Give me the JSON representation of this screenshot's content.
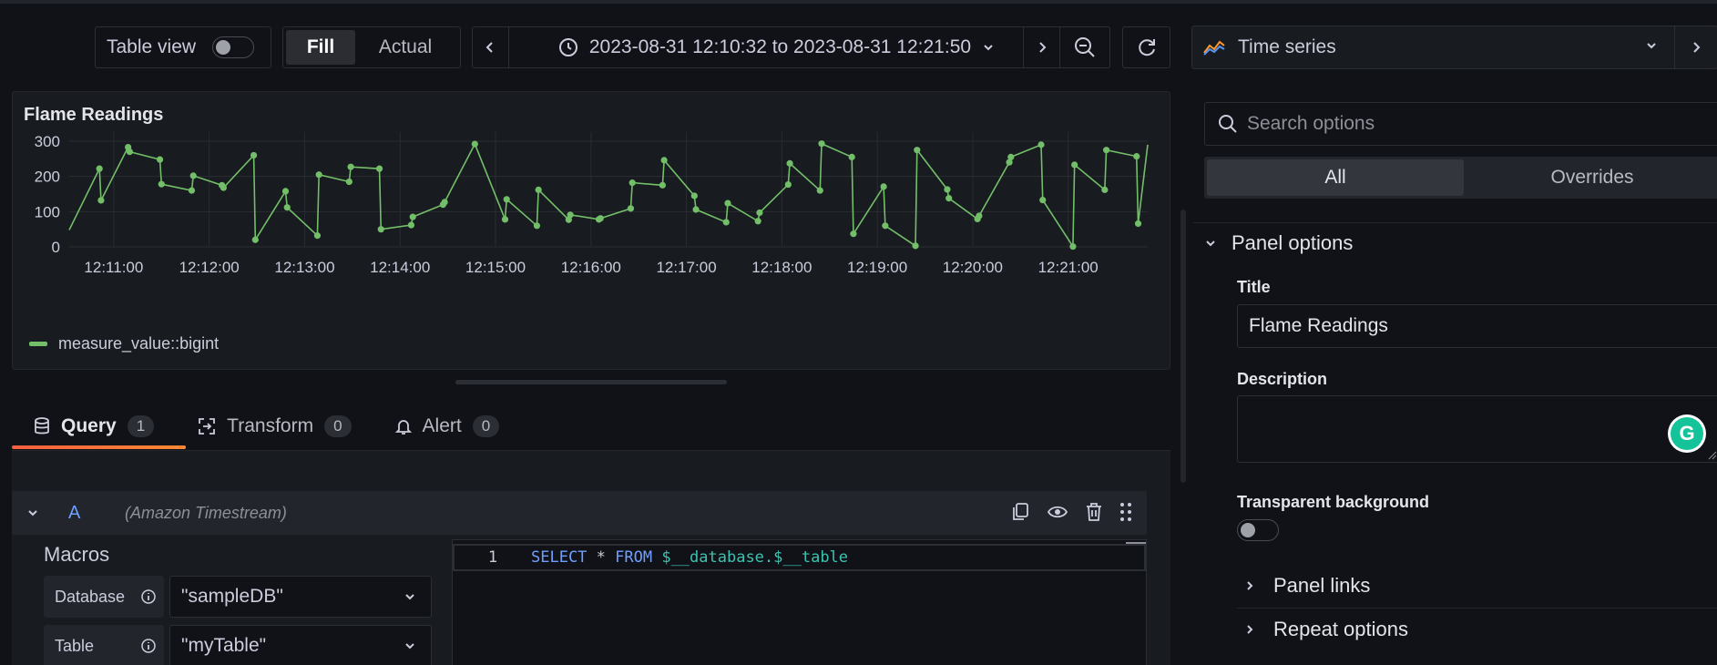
{
  "toolbar": {
    "table_view_label": "Table view",
    "fill_label": "Fill",
    "actual_label": "Actual",
    "time_range": "2023-08-31 12:10:32 to 2023-08-31 12:21:50"
  },
  "viz_picker": {
    "label": "Time series",
    "icon": "timeseries-icon"
  },
  "panel": {
    "title": "Flame Readings",
    "legend_label": "measure_value::bigint"
  },
  "chart_data": {
    "type": "line",
    "series": [
      {
        "name": "measure_value::bigint",
        "color": "#73bf69",
        "x": [
          "12:10:32",
          "12:10:51",
          "12:10:52",
          "12:11:09",
          "12:11:10",
          "12:11:29",
          "12:11:30",
          "12:11:49",
          "12:11:50",
          "12:12:08",
          "12:12:09",
          "12:12:28",
          "12:12:29",
          "12:12:48",
          "12:12:49",
          "12:13:08",
          "12:13:09",
          "12:13:28",
          "12:13:29",
          "12:13:47",
          "12:13:48",
          "12:14:07",
          "12:14:08",
          "12:14:27",
          "12:14:28",
          "12:14:47",
          "12:15:06",
          "12:15:07",
          "12:15:26",
          "12:15:27",
          "12:15:46",
          "12:15:47",
          "12:16:05",
          "12:16:06",
          "12:16:25",
          "12:16:26",
          "12:16:45",
          "12:16:46",
          "12:17:05",
          "12:17:06",
          "12:17:25",
          "12:17:26",
          "12:17:45",
          "12:17:46",
          "12:18:04",
          "12:18:05",
          "12:18:24",
          "12:18:25",
          "12:18:44",
          "12:18:45",
          "12:19:04",
          "12:19:05",
          "12:19:24",
          "12:19:25",
          "12:19:44",
          "12:19:45",
          "12:20:03",
          "12:20:04",
          "12:20:23",
          "12:20:24",
          "12:20:43",
          "12:20:44",
          "12:21:03",
          "12:21:04",
          "12:21:23",
          "12:21:24",
          "12:21:43",
          "12:21:44",
          "12:21:50"
        ],
        "values": [
          48,
          222,
          132,
          283,
          270,
          248,
          178,
          160,
          202,
          175,
          168,
          260,
          20,
          158,
          112,
          32,
          205,
          185,
          227,
          222,
          50,
          62,
          85,
          120,
          127,
          292,
          78,
          135,
          60,
          162,
          77,
          91,
          78,
          81,
          109,
          182,
          175,
          246,
          145,
          106,
          70,
          124,
          73,
          97,
          177,
          237,
          160,
          293,
          255,
          37,
          171,
          60,
          3,
          275,
          163,
          138,
          79,
          88,
          240,
          255,
          290,
          133,
          1,
          233,
          162,
          275,
          257,
          66,
          290
        ]
      }
    ],
    "x_ticks": [
      "12:11:00",
      "12:12:00",
      "12:13:00",
      "12:14:00",
      "12:15:00",
      "12:16:00",
      "12:17:00",
      "12:18:00",
      "12:19:00",
      "12:20:00",
      "12:21:00"
    ],
    "y_ticks": [
      "0",
      "100",
      "200",
      "300"
    ],
    "ylim": [
      0,
      300
    ],
    "grid": true,
    "legend_position": "bottom-left"
  },
  "tabs": [
    {
      "label": "Query",
      "count": "1",
      "icon": "database-icon"
    },
    {
      "label": "Transform",
      "count": "0",
      "icon": "transform-icon"
    },
    {
      "label": "Alert",
      "count": "0",
      "icon": "bell-icon"
    }
  ],
  "query": {
    "ref_id": "A",
    "datasource": "(Amazon Timestream)",
    "macros_title": "Macros",
    "database_label": "Database",
    "database_value": "\"sampleDB\"",
    "table_label": "Table",
    "table_value": "\"myTable\"",
    "editor_line_number": "1",
    "sql": {
      "select": "SELECT",
      "star": " * ",
      "from": "FROM",
      "target": " $__database.$__table"
    }
  },
  "options": {
    "search_placeholder": "Search options",
    "tab_all": "All",
    "tab_overrides": "Overrides",
    "section_panel_options": "Panel options",
    "title_label": "Title",
    "title_value": "Flame Readings",
    "description_label": "Description",
    "transparent_label": "Transparent background",
    "panel_links": "Panel links",
    "repeat_options": "Repeat options"
  }
}
